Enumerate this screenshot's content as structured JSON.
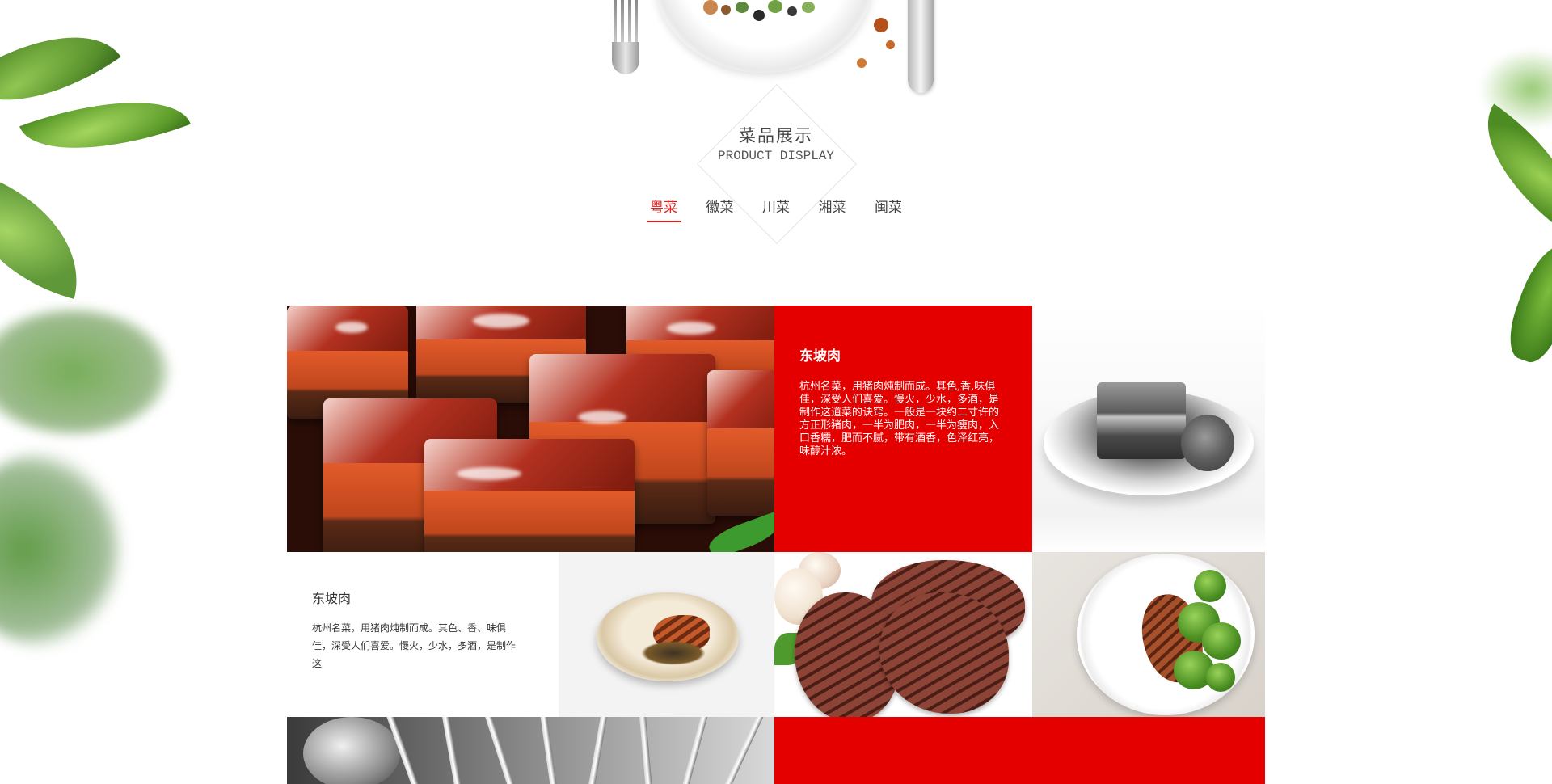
{
  "section": {
    "title": "菜品展示",
    "subtitle": "PRODUCT DISPLAY"
  },
  "tabs": [
    {
      "label": "粤菜",
      "active": true
    },
    {
      "label": "徽菜",
      "active": false
    },
    {
      "label": "川菜",
      "active": false
    },
    {
      "label": "湘菜",
      "active": false
    },
    {
      "label": "闽菜",
      "active": false
    }
  ],
  "featured": {
    "title": "东坡肉",
    "description": "杭州名菜，用猪肉炖制而成。其色,香,味俱佳，深受人们喜爱。慢火，少水，多酒，是制作这道菜的诀窍。一般是一块约二寸许的方正形猪肉，一半为肥肉，一半为瘦肉，入口香糯，肥而不腻，带有酒香，色泽红亮，味醇汁浓。"
  },
  "secondary": {
    "title": "东坡肉",
    "description": "杭州名菜，用猪肉炖制而成。其色、香、味俱佳，深受人们喜爱。慢火，少水，多酒，是制作这"
  },
  "colors": {
    "accent": "#e50000",
    "tab_active": "#e31d1a"
  }
}
